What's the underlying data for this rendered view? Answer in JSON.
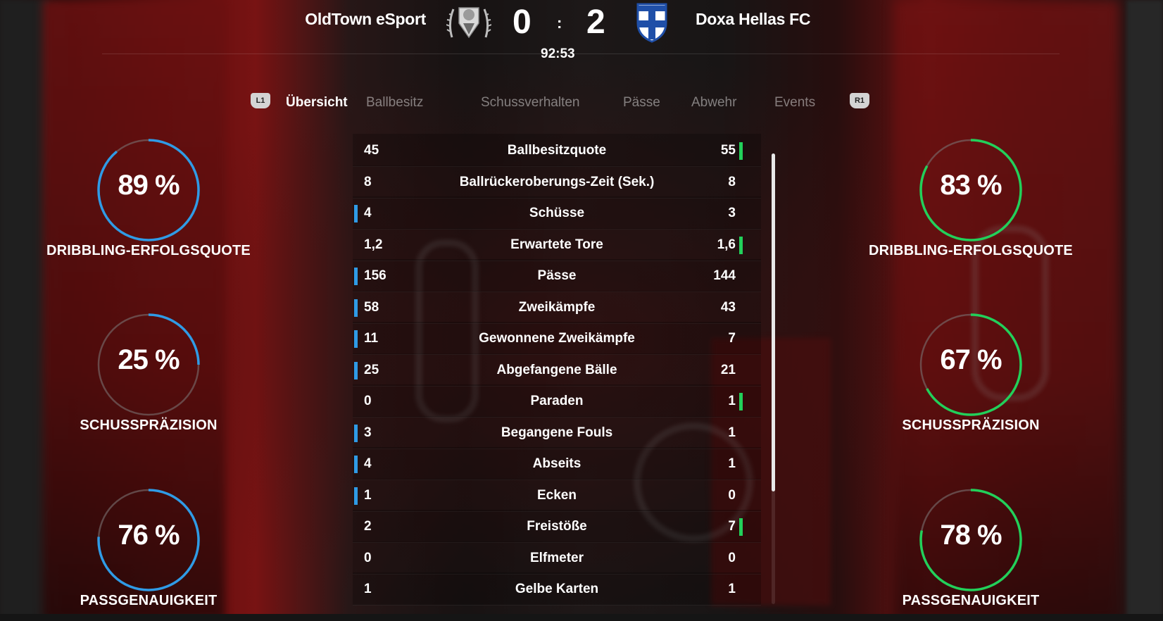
{
  "match": {
    "home_team": "OldTown eSport",
    "away_team": "Doxa Hellas FC",
    "home_score": "0",
    "away_score": "2",
    "separator": ":",
    "clock": "92:53"
  },
  "tabs": {
    "left_shoulder": "L1",
    "right_shoulder": "R1",
    "items": [
      "Übersicht",
      "Ballbesitz",
      "Schussverhalten",
      "Pässe",
      "Abwehr",
      "Events"
    ],
    "active": "Übersicht"
  },
  "stats": [
    {
      "label": "Ballbesitzquote",
      "home": "45",
      "away": "55",
      "leader": "away"
    },
    {
      "label": "Ballrückeroberungs-Zeit (Sek.)",
      "home": "8",
      "away": "8",
      "leader": "none"
    },
    {
      "label": "Schüsse",
      "home": "4",
      "away": "3",
      "leader": "home"
    },
    {
      "label": "Erwartete Tore",
      "home": "1,2",
      "away": "1,6",
      "leader": "away"
    },
    {
      "label": "Pässe",
      "home": "156",
      "away": "144",
      "leader": "home"
    },
    {
      "label": "Zweikämpfe",
      "home": "58",
      "away": "43",
      "leader": "home"
    },
    {
      "label": "Gewonnene Zweikämpfe",
      "home": "11",
      "away": "7",
      "leader": "home"
    },
    {
      "label": "Abgefangene Bälle",
      "home": "25",
      "away": "21",
      "leader": "home"
    },
    {
      "label": "Paraden",
      "home": "0",
      "away": "1",
      "leader": "away"
    },
    {
      "label": "Begangene Fouls",
      "home": "3",
      "away": "1",
      "leader": "home"
    },
    {
      "label": "Abseits",
      "home": "4",
      "away": "1",
      "leader": "home"
    },
    {
      "label": "Ecken",
      "home": "1",
      "away": "0",
      "leader": "home"
    },
    {
      "label": "Freistöße",
      "home": "2",
      "away": "7",
      "leader": "away"
    },
    {
      "label": "Elfmeter",
      "home": "0",
      "away": "0",
      "leader": "none"
    },
    {
      "label": "Gelbe Karten",
      "home": "1",
      "away": "1",
      "leader": "none"
    }
  ],
  "gauges": {
    "home": [
      {
        "value": 89,
        "text": "89 %",
        "label": "DRIBBLING-ERFOLGSQUOTE"
      },
      {
        "value": 25,
        "text": "25 %",
        "label": "SCHUSSPRÄZISION"
      },
      {
        "value": 76,
        "text": "76 %",
        "label": "PASSGENAUIGKEIT"
      }
    ],
    "away": [
      {
        "value": 83,
        "text": "83 %",
        "label": "DRIBBLING-ERFOLGSQUOTE"
      },
      {
        "value": 67,
        "text": "67 %",
        "label": "SCHUSSPRÄZISION"
      },
      {
        "value": 78,
        "text": "78 %",
        "label": "PASSGENAUIGKEIT"
      }
    ]
  },
  "colors": {
    "home_accent": "#2f9be6",
    "away_accent": "#22d05a",
    "gauge_track": "#7a7272",
    "away_crest_blue": "#1f4fa8"
  },
  "scroll": {
    "position": 0,
    "visible_fraction": 0.75
  }
}
